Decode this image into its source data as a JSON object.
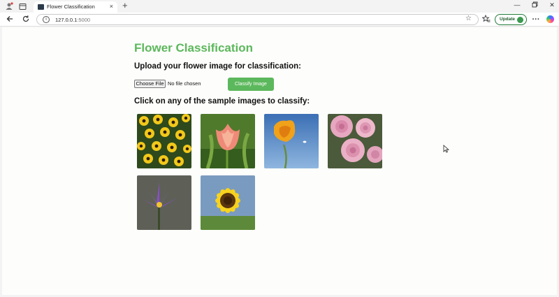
{
  "browser": {
    "tab_title": "Flower Classification",
    "tab_close": "×",
    "new_tab": "+",
    "url_host": "127.0.0.1",
    "url_port": ":5000",
    "update_label": "Update",
    "icons": [
      "profile-icon",
      "tab-actions-icon",
      "back-icon",
      "reload-icon",
      "site-info-icon",
      "favorite-star-icon",
      "favorites-icon",
      "more-icon",
      "copilot-icon",
      "minimize-icon",
      "maximize-icon",
      "close-icon"
    ]
  },
  "page": {
    "title": "Flower Classification",
    "upload_heading": "Upload your flower image for classification:",
    "choose_file_label": "Choose File",
    "file_status": "No file chosen",
    "classify_label": "Classify Image",
    "samples_heading": "Click on any of the sample images to classify:",
    "samples": [
      {
        "name": "sample-daisies"
      },
      {
        "name": "sample-tulip"
      },
      {
        "name": "sample-poppy"
      },
      {
        "name": "sample-roses"
      },
      {
        "name": "sample-waterlily"
      },
      {
        "name": "sample-sunflower"
      }
    ],
    "accent_color": "#5cb85c"
  }
}
